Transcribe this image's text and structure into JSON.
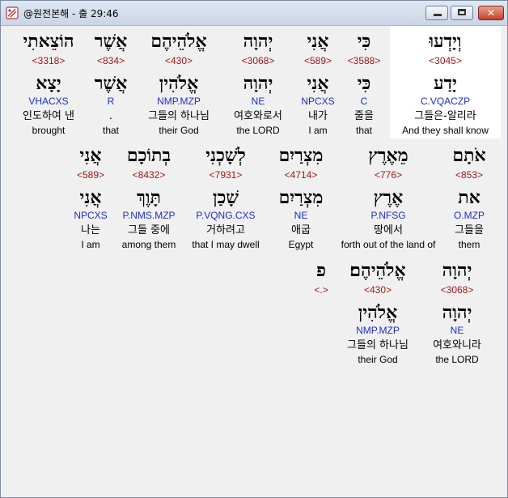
{
  "window": {
    "title": "@원전본해 - 출 29:46",
    "controls": {
      "minimize": "",
      "maximize": "",
      "close": "✕"
    }
  },
  "lines": [
    {
      "words": [
        {
          "hebrew": "וְיָדְעוּ",
          "strong": "<3045>",
          "root": "יָדַע",
          "morph": "C.VQACZP",
          "korean": "그들은-알리라",
          "english": "And they shall know"
        },
        {
          "hebrew": "כִּי",
          "strong": "<3588>",
          "root": "כִּי",
          "morph": "C",
          "korean": "줄을",
          "english": "that"
        },
        {
          "hebrew": "אֲנִי",
          "strong": "<589>",
          "root": "אֲנִי",
          "morph": "NPCXS",
          "korean": "내가",
          "english": "I am"
        },
        {
          "hebrew": "יְהוָה",
          "strong": "<3068>",
          "root": "יְהוָה",
          "morph": "NE",
          "korean": "여호와로서",
          "english": "the LORD"
        },
        {
          "hebrew": "אֱלֹהֵיהֶם",
          "strong": "<430>",
          "root": "אֱלֹהִין",
          "morph": "NMP.MZP",
          "korean": "그들의 하나님",
          "english": "their God"
        },
        {
          "hebrew": "אֲשֶׁר",
          "strong": "<834>",
          "root": "אֲשֶׁר",
          "morph": "R",
          "korean": ".",
          "english": "that"
        },
        {
          "hebrew": "הוֹצֵאתִי",
          "strong": "<3318>",
          "root": "יָצָא",
          "morph": "VHACXS",
          "korean": "인도하여 낸",
          "english": "brought"
        }
      ]
    },
    {
      "words": [
        {
          "hebrew": "אֹתָם",
          "strong": "<853>",
          "root": "את",
          "morph": "O.MZP",
          "korean": "그들을",
          "english": "them"
        },
        {
          "hebrew": "מֵאֶרֶץ",
          "strong": "<776>",
          "root": "אֶרֶץ",
          "morph": "P.NFSG",
          "korean": "땅에서",
          "english": "forth out of the land of"
        },
        {
          "hebrew": "מִצְרַיִם",
          "strong": "<4714>",
          "root": "מִצְרַיִם",
          "morph": "NE",
          "korean": "애굽",
          "english": "Egypt"
        },
        {
          "hebrew": "לְשָׁכְנִי",
          "strong": "<7931>",
          "root": "שָׁכַן",
          "morph": "P.VQNG.CXS",
          "korean": "거하려고",
          "english": "that I may dwell"
        },
        {
          "hebrew": "בְתוֹכָם",
          "strong": "<8432>",
          "root": "תָּוֶךְ",
          "morph": "P.NMS.MZP",
          "korean": "그들 중에",
          "english": "among them"
        },
        {
          "hebrew": "אֲנִי",
          "strong": "<589>",
          "root": "אֲנִי",
          "morph": "NPCXS",
          "korean": "나는",
          "english": "I am"
        }
      ]
    },
    {
      "words": [
        {
          "hebrew": "יְהוָה",
          "strong": "<3068>",
          "root": "יְהוָה",
          "morph": "NE",
          "korean": "여호와니라",
          "english": "the LORD"
        },
        {
          "hebrew": "אֱלֹהֵיהֶם׃",
          "strong": "<430>",
          "root": "אֱלֹהִין",
          "morph": "NMP.MZP",
          "korean": "그들의 하나님",
          "english": "their God"
        },
        {
          "hebrew": "פ",
          "strong": "<.>",
          "root": "",
          "morph": "",
          "korean": "",
          "english": ""
        }
      ]
    }
  ]
}
